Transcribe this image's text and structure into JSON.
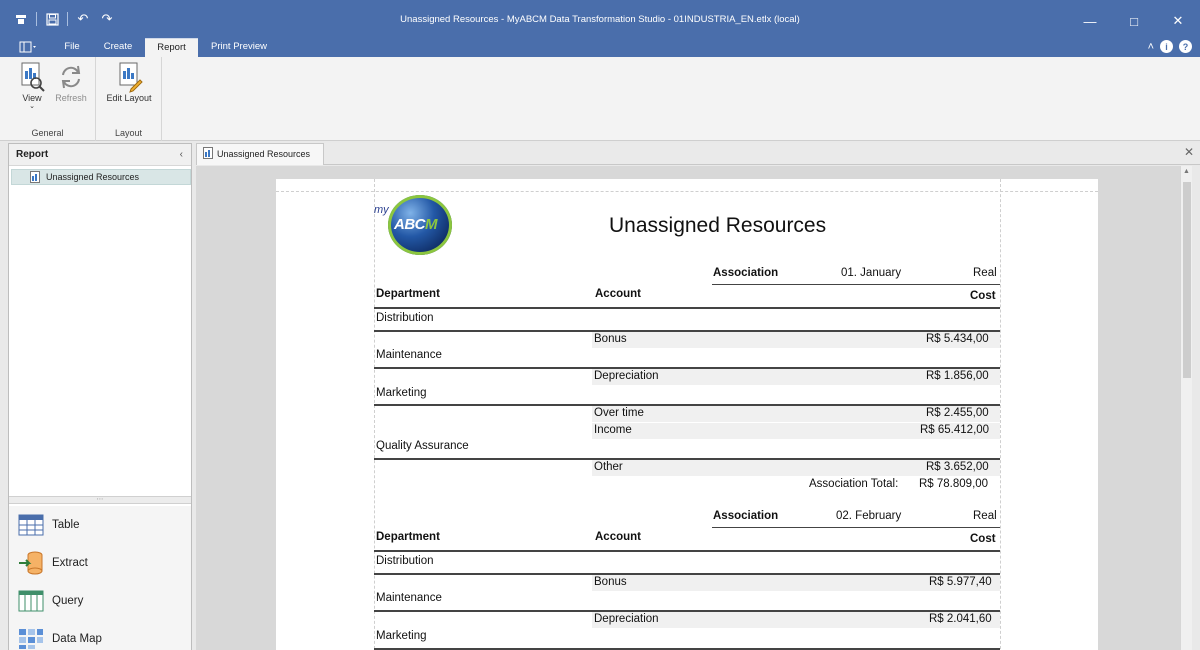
{
  "window": {
    "title": "Unassigned Resources - MyABCM Data Transformation Studio - 01INDUSTRIA_EN.etlx (local)"
  },
  "tabs": [
    {
      "label": "File"
    },
    {
      "label": "Create"
    },
    {
      "label": "Report"
    },
    {
      "label": "Print Preview"
    }
  ],
  "ribbon": {
    "general": {
      "label": "General",
      "view": "View",
      "refresh": "Refresh"
    },
    "layout": {
      "label": "Layout",
      "edit_layout": "Edit Layout"
    }
  },
  "left_panel": {
    "header": "Report",
    "tree_item": "Unassigned Resources",
    "nav": [
      {
        "label": "Table",
        "icon": "table-icon"
      },
      {
        "label": "Extract",
        "icon": "extract-icon"
      },
      {
        "label": "Query",
        "icon": "query-icon"
      },
      {
        "label": "Data Map",
        "icon": "data-map-icon"
      }
    ]
  },
  "document_tab": {
    "label": "Unassigned Resources"
  },
  "report": {
    "logo": {
      "prefix": "my",
      "main": "ABC",
      "accent": "M"
    },
    "title": "Unassigned Resources",
    "headers": {
      "department": "Department",
      "account": "Account",
      "cost": "Cost",
      "association": "Association"
    },
    "sections": [
      {
        "period": "01. January",
        "scenario": "Real",
        "rows": [
          {
            "department": "Distribution",
            "account": "Bonus",
            "cost": "R$ 5.434,00"
          },
          {
            "department": "Maintenance",
            "account": "Depreciation",
            "cost": "R$ 1.856,00"
          },
          {
            "department": "Marketing",
            "account": "Over time",
            "cost": "R$ 2.455,00"
          },
          {
            "department": "",
            "account": "Income",
            "cost": "R$ 65.412,00"
          },
          {
            "department": "Quality Assurance",
            "account": "Other",
            "cost": "R$ 3.652,00"
          }
        ],
        "total_label": "Association Total:",
        "total_value": "R$ 78.809,00"
      },
      {
        "period": "02. February",
        "scenario": "Real",
        "rows": [
          {
            "department": "Distribution",
            "account": "Bonus",
            "cost": "R$ 5.977,40"
          },
          {
            "department": "Maintenance",
            "account": "Depreciation",
            "cost": "R$ 2.041,60"
          },
          {
            "department": "Marketing",
            "account": "",
            "cost": ""
          }
        ]
      }
    ]
  }
}
